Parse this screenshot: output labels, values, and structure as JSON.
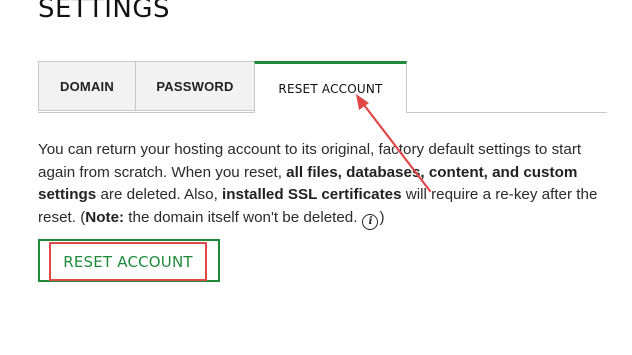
{
  "page": {
    "title": "SETTINGS"
  },
  "tabs": [
    {
      "label": "DOMAIN",
      "active": false
    },
    {
      "label": "PASSWORD",
      "active": false
    },
    {
      "label": "RESET ACCOUNT",
      "active": true
    }
  ],
  "description": {
    "part1": "You can return your hosting account to its original, factory default settings to start again from scratch. When you reset, ",
    "bold1": "all files, databases, content, and custom settings",
    "part2": " are deleted. Also, ",
    "bold2": "installed SSL certificates",
    "part3": " will require a re-key after the reset. (",
    "note_label": "Note:",
    "note_text": " the domain itself won't be deleted.",
    "info_icon_glyph": "i",
    "closing": ")"
  },
  "reset_button": {
    "label": "RESET ACCOUNT"
  },
  "icons": {
    "info": "info-circle-icon",
    "annotation_arrow": "red-arrow-annotation"
  },
  "colors": {
    "accent_green": "#1f8b3a",
    "annotation_red": "#e04848",
    "tab_inactive_bg": "#f2f2f2",
    "tab_border": "#c8c8c8"
  }
}
